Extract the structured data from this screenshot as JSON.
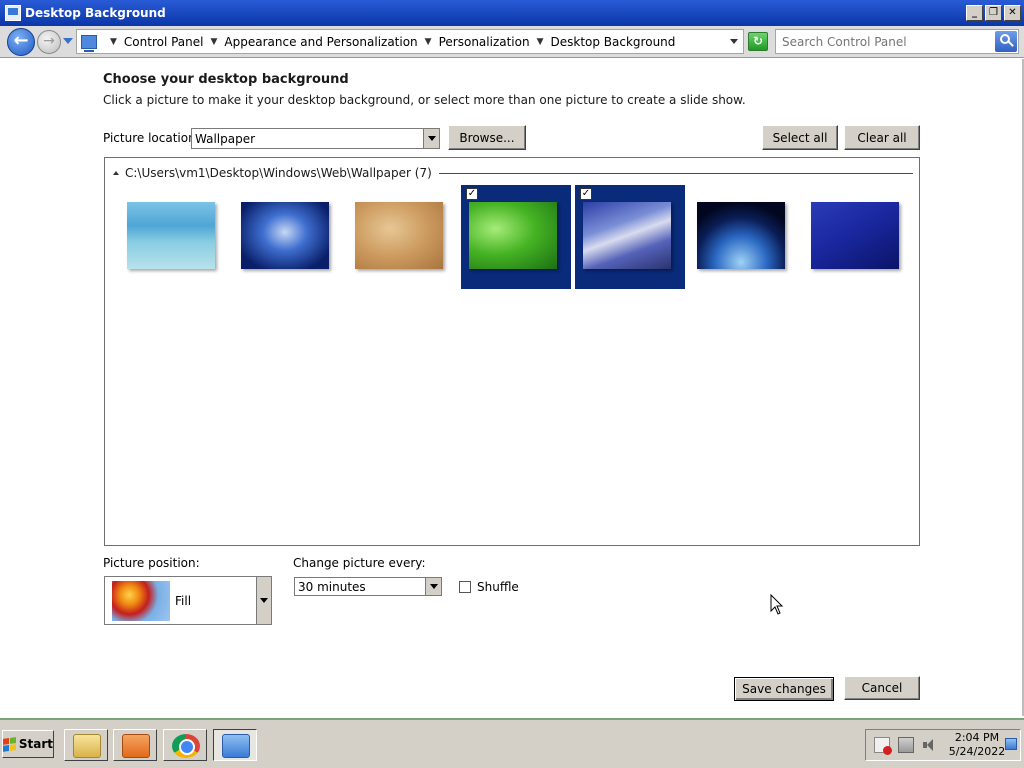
{
  "window": {
    "title": "Desktop Background",
    "controls": {
      "minimize": "_",
      "restore": "❐",
      "close": "✕"
    }
  },
  "address_bar": {
    "breadcrumbs": [
      "Control Panel",
      "Appearance and Personalization",
      "Personalization",
      "Desktop Background"
    ],
    "search_placeholder": "Search Control Panel"
  },
  "main": {
    "heading": "Choose your desktop background",
    "subtext": "Click a picture to make it your desktop background, or select more than one picture to create a slide show.",
    "picture_location_label": "Picture location:",
    "picture_location_value": "Wallpaper",
    "browse_label": "Browse...",
    "select_all_label": "Select all",
    "clear_all_label": "Clear all",
    "gallery": {
      "group_path": "C:\\Users\\vm1\\Desktop\\Windows\\Web\\Wallpaper (7)",
      "pictures": [
        {
          "theme": "underwater-starfish",
          "selected": false
        },
        {
          "theme": "blue-light-burst",
          "selected": false
        },
        {
          "theme": "sand-dunes",
          "selected": false
        },
        {
          "theme": "green-leaf-dew",
          "selected": true
        },
        {
          "theme": "blue-waterfall",
          "selected": true
        },
        {
          "theme": "earth-from-space",
          "selected": false
        },
        {
          "theme": "star-trails-mountain",
          "selected": false
        }
      ]
    },
    "picture_position_label": "Picture position:",
    "picture_position_value": "Fill",
    "change_picture_label": "Change picture every:",
    "change_picture_value": "30 minutes",
    "shuffle_label": "Shuffle",
    "shuffle_checked": false,
    "save_label": "Save changes",
    "cancel_label": "Cancel"
  },
  "taskbar": {
    "start_label": "Start",
    "apps": [
      "windows-explorer",
      "media-player",
      "chrome",
      "control-panel"
    ],
    "clock_time": "2:04 PM",
    "clock_date": "5/24/2022"
  },
  "colors": {
    "title_bar": "#0a36a8",
    "selection": "#0a2a7a",
    "taskbar": "#d4d0c8"
  }
}
